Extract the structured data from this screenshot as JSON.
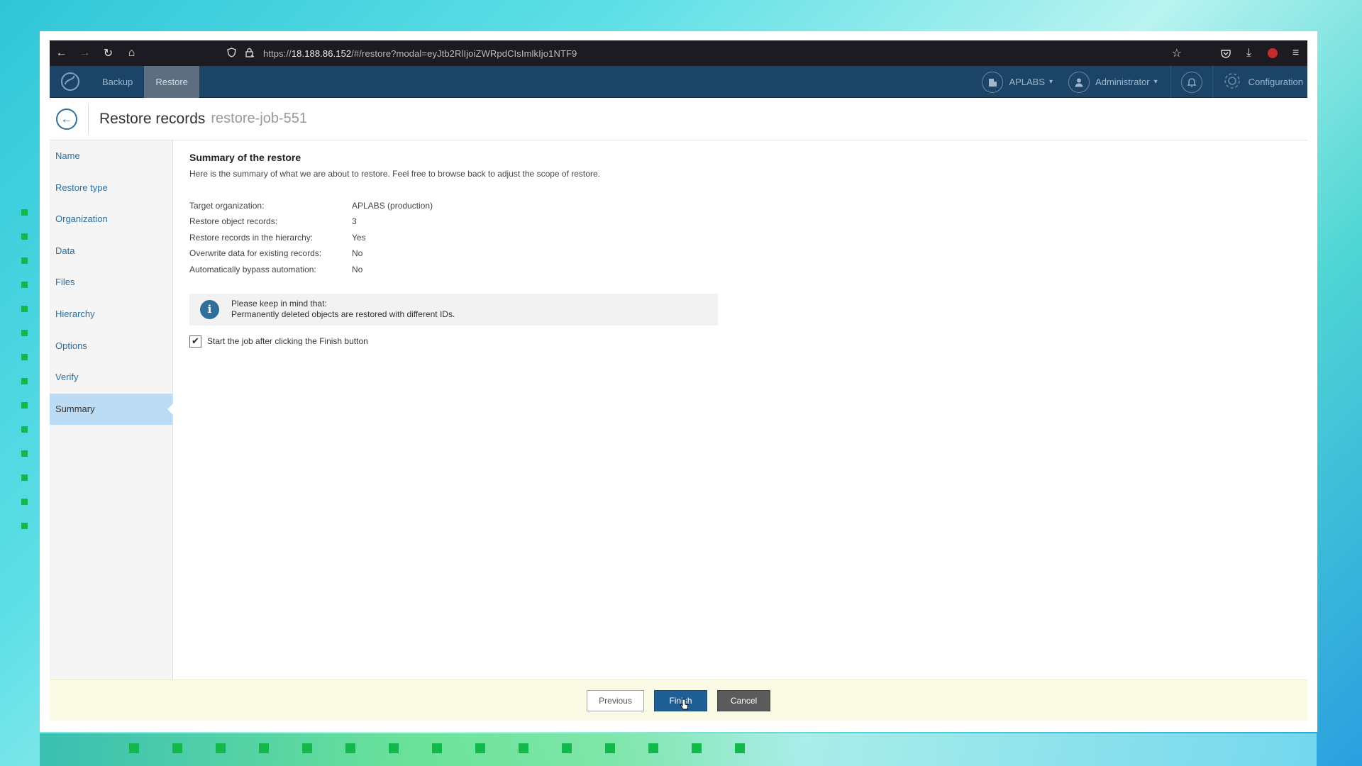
{
  "browser": {
    "url_prefix": "https://",
    "url_host": "18.188.86.152",
    "url_path": "/#/restore?modal=eyJtb2RlIjoiZWRpdCIsImlkIjo1NTF9"
  },
  "header": {
    "tabs": [
      {
        "label": "Backup",
        "active": false
      },
      {
        "label": "Restore",
        "active": true
      }
    ],
    "org_label": "APLABS",
    "user_label": "Administrator",
    "config_label": "Configuration"
  },
  "title": {
    "main": "Restore records",
    "job": "restore-job-551"
  },
  "sidebar": {
    "items": [
      {
        "label": "Name"
      },
      {
        "label": "Restore type"
      },
      {
        "label": "Organization"
      },
      {
        "label": "Data"
      },
      {
        "label": "Files"
      },
      {
        "label": "Hierarchy"
      },
      {
        "label": "Options"
      },
      {
        "label": "Verify"
      },
      {
        "label": "Summary",
        "active": true
      }
    ]
  },
  "summary": {
    "title": "Summary of the restore",
    "description": "Here is the summary of what we are about to restore. Feel free to browse back to adjust the scope of restore.",
    "rows": [
      {
        "key": "Target organization:",
        "value": "APLABS (production)"
      },
      {
        "key": "Restore object records:",
        "value": "3"
      },
      {
        "key": "Restore records in the hierarchy:",
        "value": "Yes"
      },
      {
        "key": "Overwrite data for existing records:",
        "value": "No"
      },
      {
        "key": "Automatically bypass automation:",
        "value": "No"
      }
    ],
    "note_line1": "Please keep in mind that:",
    "note_line2": "Permanently deleted objects are restored with different IDs.",
    "checkbox_label": "Start the job after clicking the Finish button",
    "checkbox_checked": true
  },
  "footer": {
    "previous": "Previous",
    "finish": "Finish",
    "cancel": "Cancel"
  },
  "colors": {
    "appbar": "#1b4466",
    "accent": "#1e5f96",
    "sidebar_active": "#bcdcf5"
  }
}
